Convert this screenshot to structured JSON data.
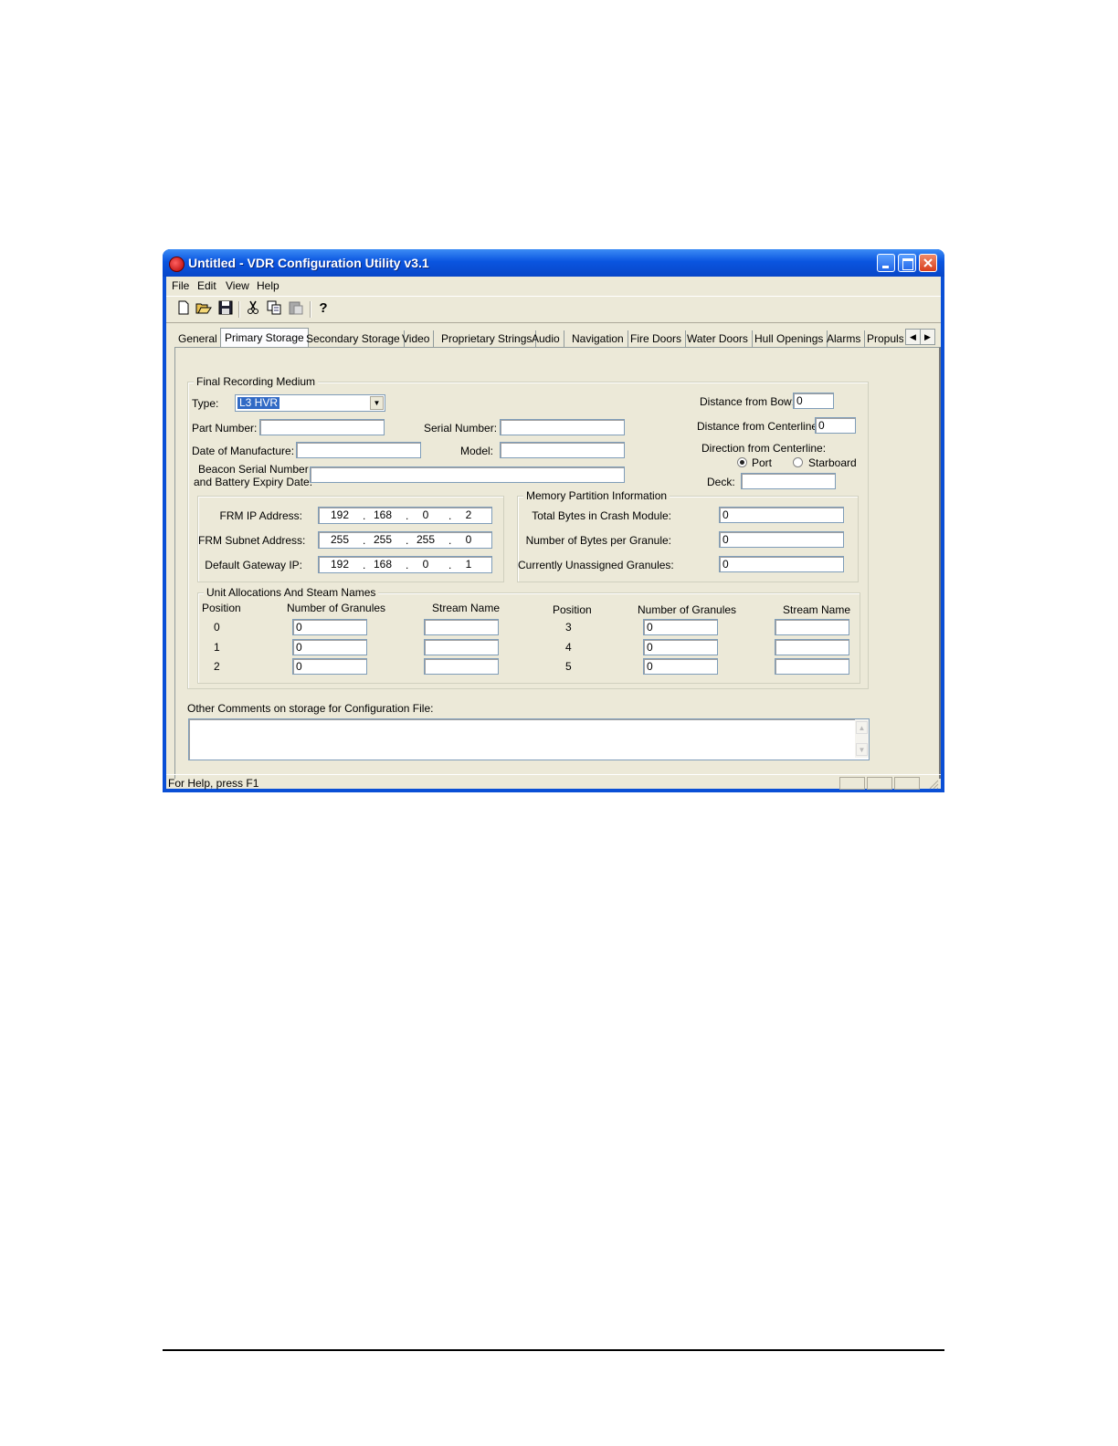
{
  "window": {
    "title": "Untitled - VDR Configuration Utility v3.1",
    "minimize": "_",
    "maximize": "□",
    "close": "✕"
  },
  "menu": [
    "File",
    "Edit",
    "View",
    "Help"
  ],
  "toolbar": [
    "new-icon",
    "open-icon",
    "save-icon",
    "cut-icon",
    "copy-icon",
    "paste-icon",
    "help-icon"
  ],
  "tabs": [
    "General",
    "Primary Storage",
    "Secondary Storage",
    "Video",
    "Proprietary Strings",
    "Audio",
    "Navigation",
    "Fire Doors",
    "Water Doors",
    "Hull Openings",
    "Alarms",
    "Propulsi"
  ],
  "frm": {
    "legend": "Final Recording Medium",
    "type_label": "Type:",
    "type_value": "L3 HVR",
    "part_number_label": "Part Number:",
    "part_number": "",
    "serial_number_label": "Serial Number:",
    "serial_number": "",
    "date_label": "Date of Manufacture:",
    "date": "",
    "model_label": "Model:",
    "model": "",
    "beacon_label_1": "Beacon Serial Number",
    "beacon_label_2": "and Battery Expiry Date:",
    "beacon": "",
    "bow_label": "Distance from Bow:",
    "bow": "0",
    "centerline_label": "Distance from Centerline:",
    "centerline": "0",
    "direction_label": "Direction from Centerline:",
    "port_label": "Port",
    "starboard_label": "Starboard",
    "deck_label": "Deck:",
    "deck": ""
  },
  "network": {
    "ip_label": "FRM IP Address:",
    "ip": [
      "192",
      "168",
      "0",
      "2"
    ],
    "subnet_label": "FRM Subnet Address:",
    "subnet": [
      "255",
      "255",
      "255",
      "0"
    ],
    "gateway_label": "Default Gateway IP:",
    "gateway": [
      "192",
      "168",
      "0",
      "1"
    ]
  },
  "memory": {
    "legend": "Memory Partition Information",
    "total_label": "Total Bytes in Crash Module:",
    "total": "0",
    "per_granule_label": "Number of Bytes per Granule:",
    "per_granule": "0",
    "unassigned_label": "Currently Unassigned Granules:",
    "unassigned": "0"
  },
  "units": {
    "legend": "Unit Allocations And Steam Names",
    "col_position": "Position",
    "col_granules": "Number of Granules",
    "col_stream": "Stream Name",
    "rows": [
      {
        "position": "0",
        "granules": "0",
        "stream": ""
      },
      {
        "position": "1",
        "granules": "0",
        "stream": ""
      },
      {
        "position": "2",
        "granules": "0",
        "stream": ""
      },
      {
        "position": "3",
        "granules": "0",
        "stream": ""
      },
      {
        "position": "4",
        "granules": "0",
        "stream": ""
      },
      {
        "position": "5",
        "granules": "0",
        "stream": ""
      }
    ]
  },
  "comments": {
    "label": "Other Comments on storage for Configuration File:",
    "value": ""
  },
  "status": "For Help, press F1"
}
